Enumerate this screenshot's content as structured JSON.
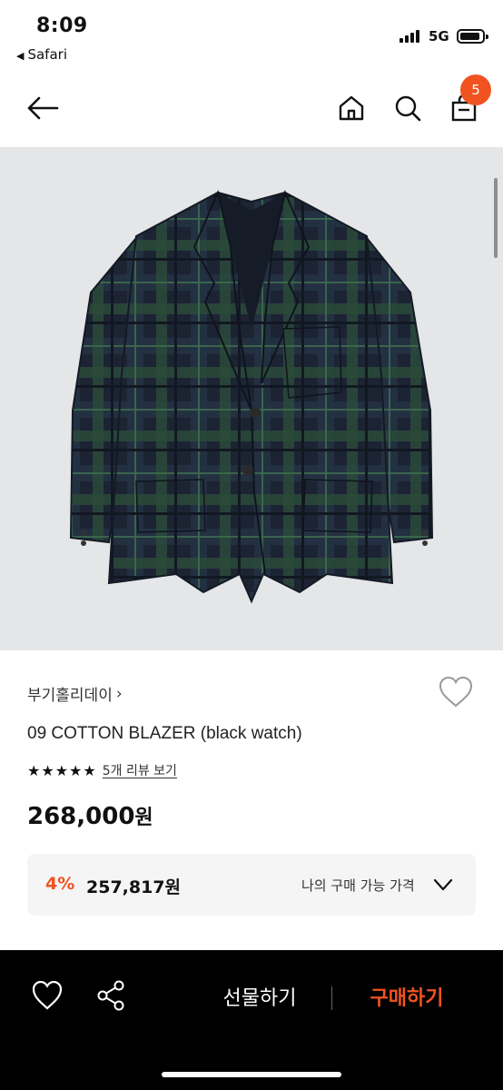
{
  "status_bar": {
    "time": "8:09",
    "back_app": "Safari",
    "network": "5G"
  },
  "header": {
    "cart_count": "5"
  },
  "product": {
    "brand": "부기홀리데이",
    "brand_chevron": "›",
    "name": "09 COTTON BLAZER (black watch)",
    "stars": "★★★★★",
    "rating": 5,
    "review_link": "5개 리뷰 보기",
    "price": "268,000",
    "price_unit": "원",
    "image": "plaid-blazer-photo"
  },
  "discount": {
    "rate": "4%",
    "price": "257,817원",
    "label": "나의 구매 가능 가격"
  },
  "bottom_bar": {
    "gift_label": "선물하기",
    "buy_label": "구매하기"
  },
  "colors": {
    "accent": "#f0531f",
    "bottom_bar": "#000000",
    "image_bg": "#e5e6e8"
  }
}
